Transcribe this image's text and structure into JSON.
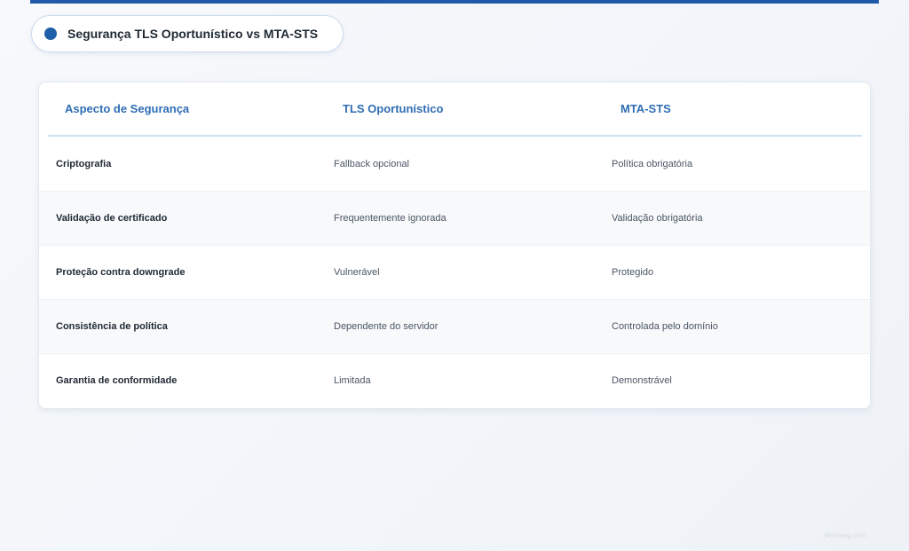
{
  "title": "Segurança TLS Oportunístico vs MTA-STS",
  "table": {
    "headers": [
      "Aspecto de Segurança",
      "TLS Oportunístico",
      "MTA-STS"
    ],
    "rows": [
      [
        "Criptografia",
        "Fallback opcional",
        "Política obrigatória"
      ],
      [
        "Validação de certificado",
        "Frequentemente ignorada",
        "Validação obrigatória"
      ],
      [
        "Proteção contra downgrade",
        "Vulnerável",
        "Protegido"
      ],
      [
        "Consistência de política",
        "Dependente do servidor",
        "Controlada pelo domínio"
      ],
      [
        "Garantia de conformidade",
        "Limitada",
        "Demonstrável"
      ]
    ]
  },
  "watermark": "skyvisag.com",
  "colors": {
    "accent": "#1e5aa8",
    "header_text": "#2f6db4",
    "dot": "#1f5ea8"
  }
}
